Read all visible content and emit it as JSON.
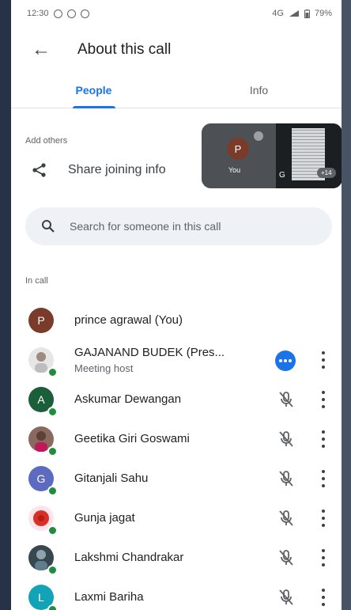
{
  "status_bar": {
    "time": "12:30",
    "network": "4G",
    "battery": "79%"
  },
  "app_bar": {
    "title": "About this call"
  },
  "tabs": [
    {
      "label": "People",
      "active": true
    },
    {
      "label": "Info",
      "active": false
    }
  ],
  "add_others": {
    "heading": "Add others",
    "share_label": "Share joining info",
    "preview": {
      "you_initial": "P",
      "you_label": "You",
      "doc_label": "G",
      "more_count": "+14"
    }
  },
  "search": {
    "placeholder": "Search for someone in this call"
  },
  "in_call": {
    "heading": "In call",
    "people": [
      {
        "name": "prince agrawal (You)",
        "initial": "P",
        "avatar_color": "#7b3b2a",
        "online": false
      },
      {
        "name": "GAJANAND BUDEK (Pres...",
        "subtitle": "Meeting host",
        "initial": "",
        "avatar_color": "#e6e6e6",
        "online": true,
        "presenting": true
      },
      {
        "name": "Askumar Dewangan",
        "initial": "A",
        "avatar_color": "#1b5e3a",
        "online": true,
        "muted": true
      },
      {
        "name": "Geetika Giri Goswami",
        "initial": "",
        "avatar_color": "#8a6a5e",
        "online": true,
        "muted": true
      },
      {
        "name": "Gitanjali Sahu",
        "initial": "G",
        "avatar_color": "#5c6bc0",
        "online": true,
        "muted": true
      },
      {
        "name": "Gunja jagat",
        "initial": "",
        "avatar_color": "#d93025",
        "online": true,
        "muted": true
      },
      {
        "name": "Lakshmi Chandrakar",
        "initial": "",
        "avatar_color": "#37474f",
        "online": true,
        "muted": true
      },
      {
        "name": "Laxmi Bariha",
        "initial": "L",
        "avatar_color": "#12a4b6",
        "online": true,
        "muted": true
      }
    ]
  },
  "colors": {
    "accent": "#1a73e8",
    "online": "#1e8e3e"
  }
}
